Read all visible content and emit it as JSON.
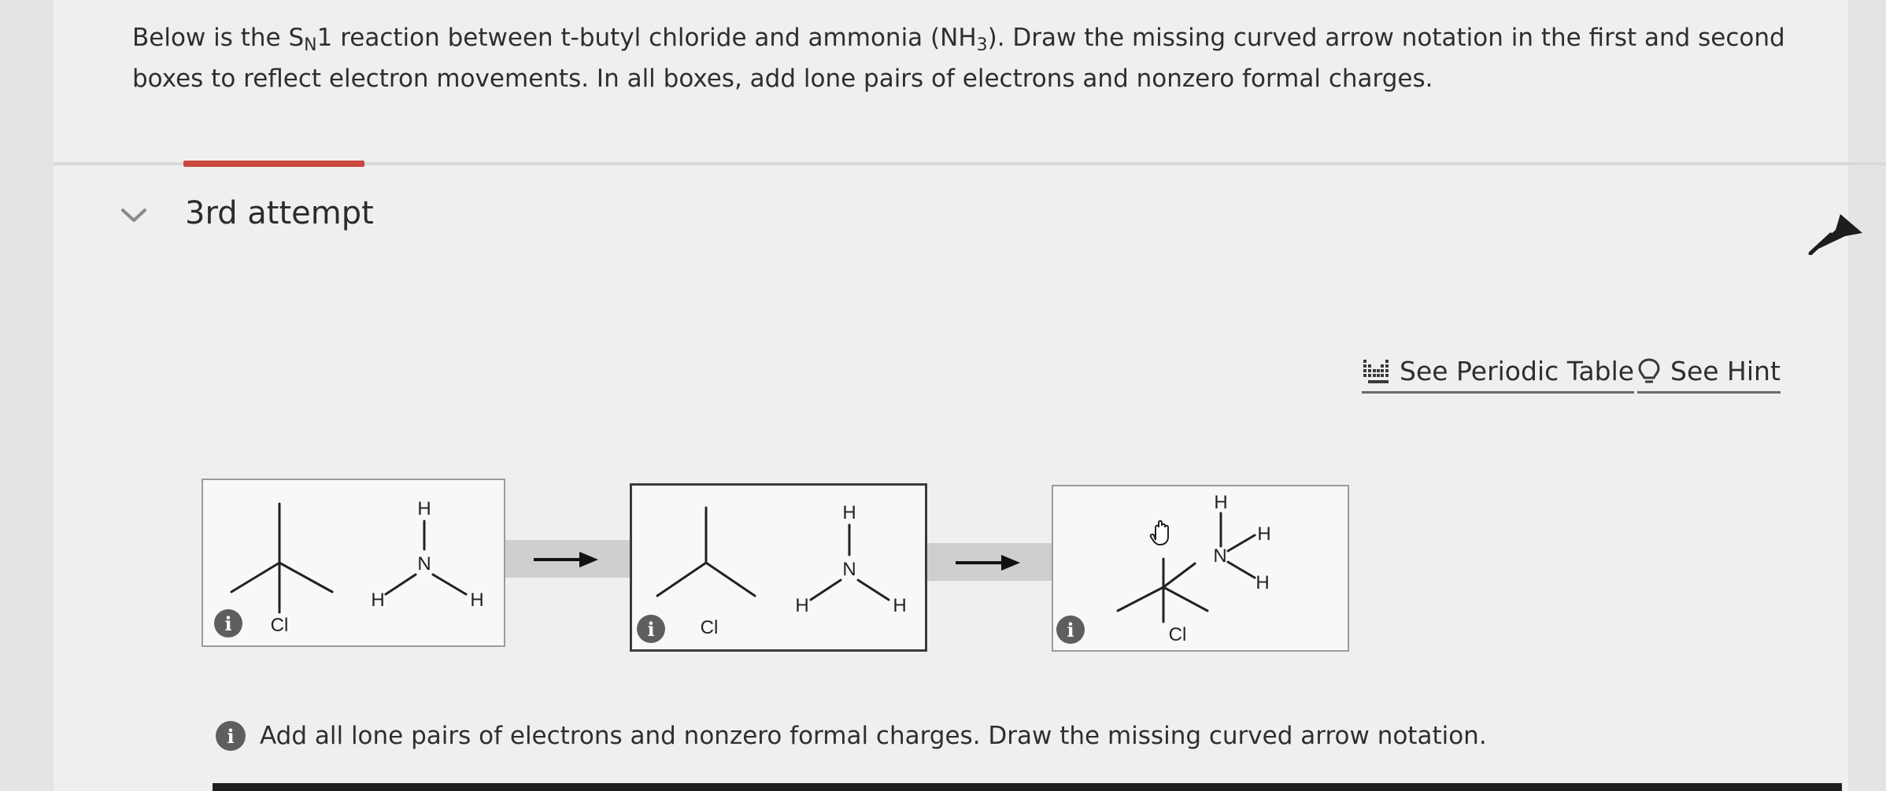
{
  "question": {
    "text_before": "Below is the S",
    "subscript_n": "N",
    "text_mid": "1 reaction between t-butyl chloride and ammonia (NH",
    "subscript_3": "3",
    "text_after": "). Draw the missing curved arrow notation in the first and second boxes to reflect electron movements. In all boxes, add lone pairs of electrons and nonzero formal charges."
  },
  "attempt": {
    "title": "3rd attempt"
  },
  "tools": {
    "periodic_table": "See Periodic Table",
    "hint": "See Hint"
  },
  "boxes": [
    {
      "atoms": {
        "cl": "Cl",
        "h_top": "H",
        "n": "N",
        "h_left": "H",
        "h_right": "H"
      }
    },
    {
      "atoms": {
        "cl": "Cl",
        "h_top": "H",
        "n": "N",
        "h_left": "H",
        "h_right": "H"
      }
    },
    {
      "atoms": {
        "cl": "Cl",
        "h_top": "H",
        "h_upper": "H",
        "n": "N",
        "h_lower": "H"
      }
    }
  ],
  "info_glyph": "i",
  "feedback": {
    "text": "Add all lone pairs of electrons and nonzero formal charges. Draw the missing curved arrow notation."
  }
}
